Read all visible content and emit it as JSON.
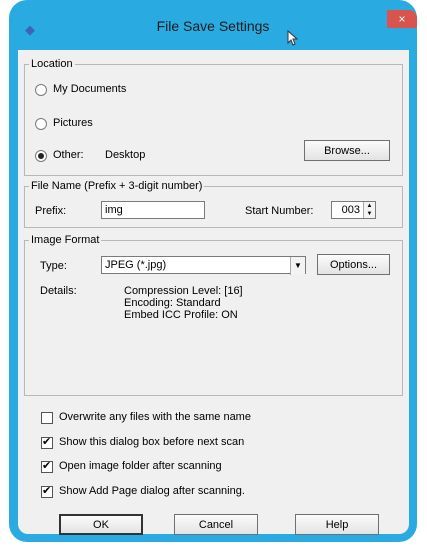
{
  "window": {
    "title": "File Save Settings",
    "close_glyph": "×"
  },
  "location": {
    "legend": "Location",
    "options": [
      {
        "label": "My Documents",
        "selected": false
      },
      {
        "label": "Pictures",
        "selected": false
      },
      {
        "label": "Other:",
        "selected": true
      }
    ],
    "other_value": "Desktop",
    "browse_label": "Browse..."
  },
  "file_name": {
    "legend": "File Name (Prefix + 3-digit number)",
    "prefix_label": "Prefix:",
    "prefix_value": "img",
    "start_number_label": "Start Number:",
    "start_number_value": "003"
  },
  "image_format": {
    "legend": "Image Format",
    "type_label": "Type:",
    "type_value": "JPEG (*.jpg)",
    "options_label": "Options...",
    "details_label": "Details:",
    "details": [
      "Compression Level: [16]",
      "Encoding: Standard",
      "Embed ICC Profile: ON"
    ]
  },
  "checkboxes": [
    {
      "label": "Overwrite any files with the same name",
      "checked": false
    },
    {
      "label": "Show this dialog box before next scan",
      "checked": true
    },
    {
      "label": "Open image folder after scanning",
      "checked": true
    },
    {
      "label": "Show Add Page dialog after scanning.",
      "checked": true
    }
  ],
  "buttons": {
    "ok": "OK",
    "cancel": "Cancel",
    "help": "Help"
  }
}
